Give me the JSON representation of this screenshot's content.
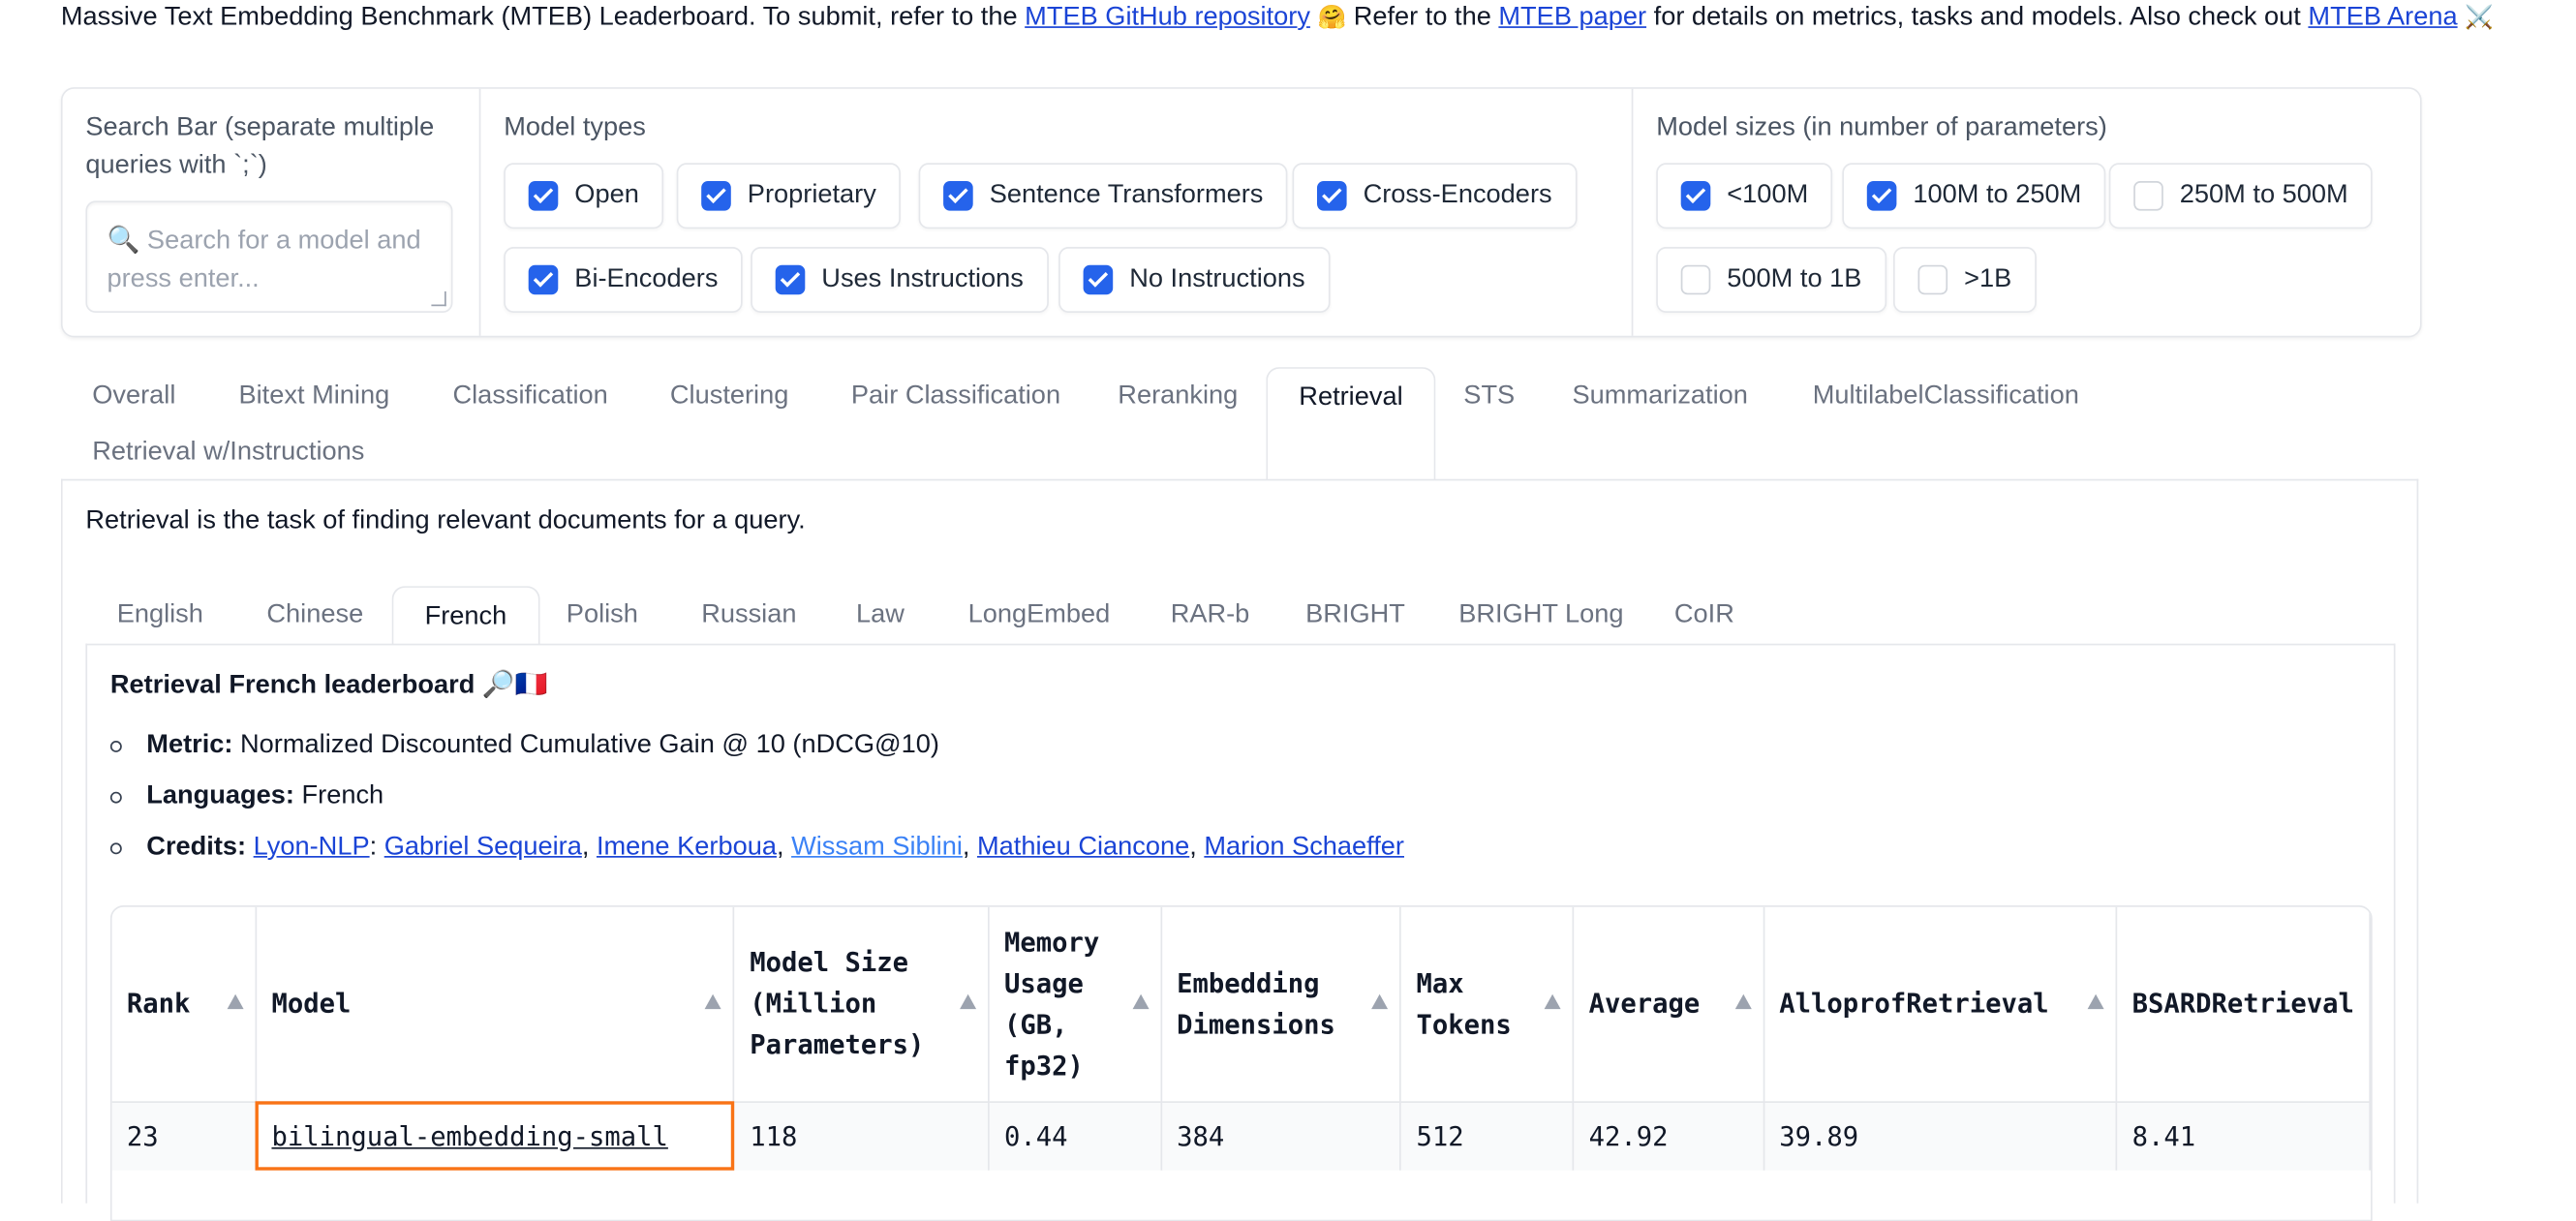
{
  "intro": {
    "text1": "Massive Text Embedding Benchmark (MTEB) Leaderboard. To submit, refer to the ",
    "link1": "MTEB GitHub repository",
    "emoji1": "🤗",
    "text2": " Refer to the ",
    "link2": "MTEB paper",
    "text3": " for details on metrics, tasks and models. Also check out ",
    "link3": "MTEB Arena",
    "emoji2": "⚔️"
  },
  "filters": {
    "search": {
      "label": "Search Bar (separate multiple queries with `;`)",
      "placeholder": "🔍 Search for a model and press enter..."
    },
    "model_types": {
      "label": "Model types",
      "options": [
        {
          "label": "Open",
          "checked": true
        },
        {
          "label": "Proprietary",
          "checked": true
        },
        {
          "label": "Sentence Transformers",
          "checked": true
        },
        {
          "label": "Cross-Encoders",
          "checked": true
        },
        {
          "label": "Bi-Encoders",
          "checked": true
        },
        {
          "label": "Uses Instructions",
          "checked": true
        },
        {
          "label": "No Instructions",
          "checked": true
        }
      ]
    },
    "model_sizes": {
      "label": "Model sizes (in number of parameters)",
      "options": [
        {
          "label": "<100M",
          "checked": true
        },
        {
          "label": "100M to 250M",
          "checked": true
        },
        {
          "label": "250M to 500M",
          "checked": false
        },
        {
          "label": "500M to 1B",
          "checked": false
        },
        {
          "label": ">1B",
          "checked": false
        }
      ]
    }
  },
  "task_tabs": [
    "Overall",
    "Bitext Mining",
    "Classification",
    "Clustering",
    "Pair Classification",
    "Reranking",
    "Retrieval",
    "STS",
    "Summarization",
    "MultilabelClassification",
    "Retrieval w/Instructions"
  ],
  "active_task_tab": "Retrieval",
  "task_description": "Retrieval is the task of finding relevant documents for a query.",
  "language_tabs": [
    "English",
    "Chinese",
    "French",
    "Polish",
    "Russian",
    "Law",
    "LongEmbed",
    "RAR-b",
    "BRIGHT",
    "BRIGHT Long",
    "CoIR"
  ],
  "active_language_tab": "French",
  "leaderboard": {
    "title": "Retrieval French leaderboard 🔎🇫🇷",
    "metric_label": "Metric:",
    "metric_value": "Normalized Discounted Cumulative Gain @ 10 (nDCG@10)",
    "languages_label": "Languages:",
    "languages_value": "French",
    "credits_label": "Credits:",
    "credits_org": "Lyon-NLP",
    "credits_people": [
      "Gabriel Sequeira",
      "Imene Kerboua",
      "Wissam Siblini",
      "Mathieu Ciancone",
      "Marion Schaeffer"
    ]
  },
  "table": {
    "headers": [
      "Rank",
      "Model",
      "Model Size (Million Parameters)",
      "Memory Usage (GB, fp32)",
      "Embedding Dimensions",
      "Max Tokens",
      "Average",
      "AlloprofRetrieval",
      "BSARDRetrieval"
    ],
    "rows": [
      [
        "23",
        "bilingual-embedding-small",
        "118",
        "0.44",
        "384",
        "512",
        "42.92",
        "39.89",
        "8.41"
      ]
    ]
  }
}
